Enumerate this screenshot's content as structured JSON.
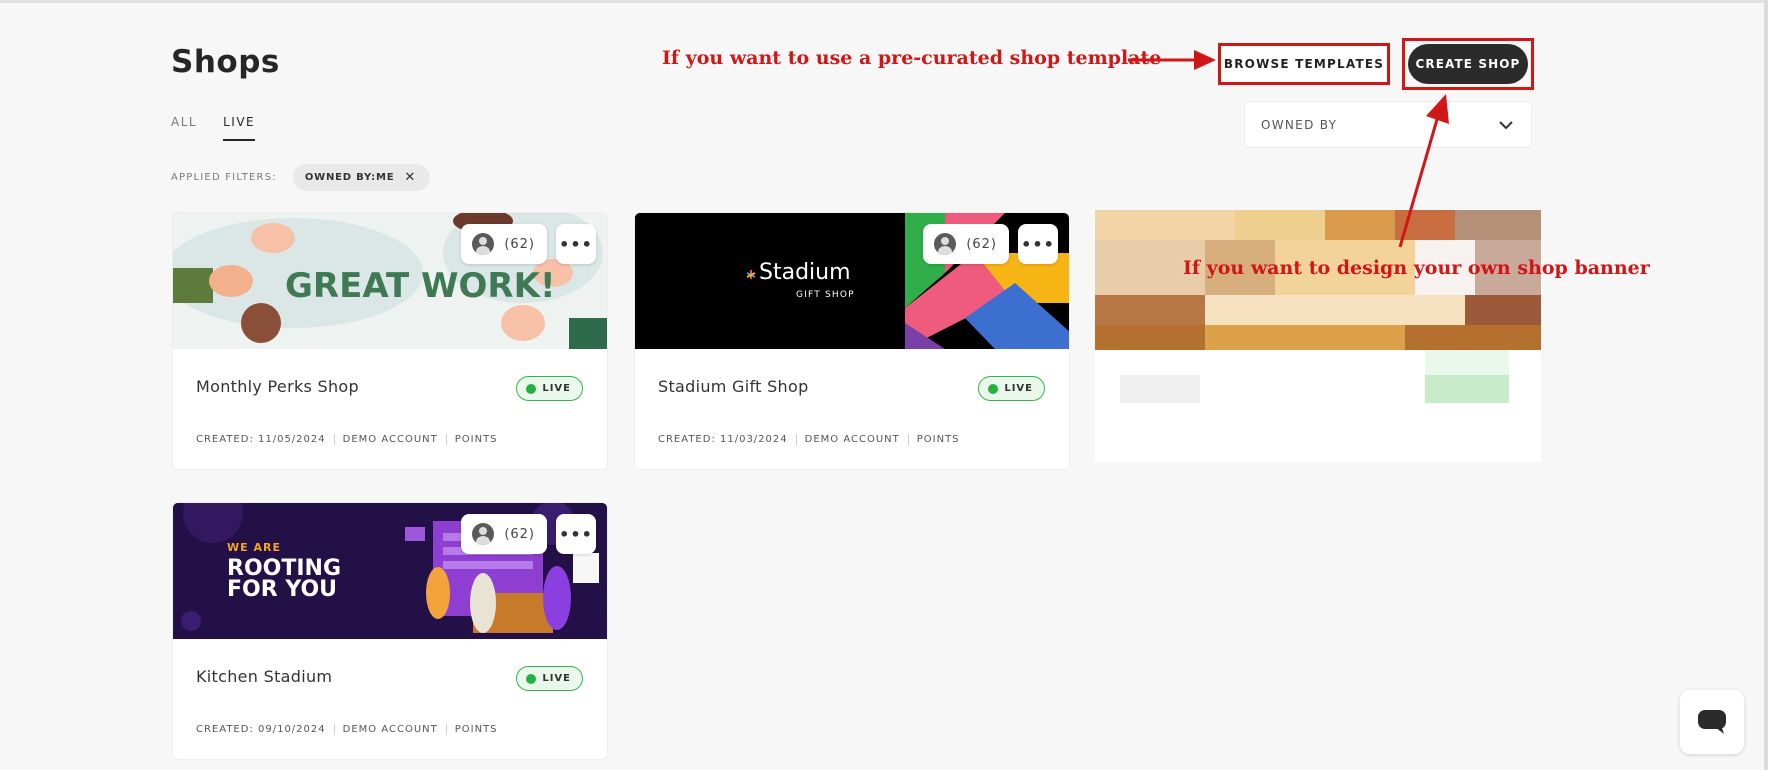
{
  "page": {
    "title": "Shops"
  },
  "tabs": [
    {
      "label": "ALL"
    },
    {
      "label": "LIVE"
    }
  ],
  "filters": {
    "label": "APPLIED FILTERS:",
    "chip": "OWNED BY:ME"
  },
  "actions": {
    "browse_label": "BROWSE TEMPLATES",
    "create_label": "CREATE SHOP"
  },
  "owned_by": {
    "label": "OWNED BY"
  },
  "annotations": {
    "browse_note": "If you want to use a pre-curated shop template",
    "create_note": "If you want to design your own shop banner"
  },
  "cards": [
    {
      "name": "Monthly Perks Shop",
      "status": "LIVE",
      "owner_count": "(62)",
      "created": "CREATED: 11/05/2024",
      "account": "DEMO ACCOUNT",
      "currency": "POINTS",
      "banner_text": "GREAT WORK!"
    },
    {
      "name": "Stadium Gift Shop",
      "status": "LIVE",
      "owner_count": "(62)",
      "created": "CREATED: 11/03/2024",
      "account": "DEMO ACCOUNT",
      "currency": "POINTS",
      "banner_title": "Stadium",
      "banner_sub": "GIFT SHOP"
    },
    {
      "name": "Kitchen Stadium",
      "status": "LIVE",
      "owner_count": "(62)",
      "created": "CREATED: 09/10/2024",
      "account": "DEMO ACCOUNT",
      "currency": "POINTS",
      "banner_kicker": "WE ARE",
      "banner_line1": "ROOTING",
      "banner_line2": "FOR YOU"
    }
  ],
  "colors": {
    "accent_dark": "#2b2b2b",
    "live_green": "#26b040",
    "annotation_red": "#d01616"
  },
  "icons": {
    "more": "more-horizontal-icon",
    "avatar": "user-avatar-icon",
    "chevron": "chevron-down-icon",
    "close": "close-icon",
    "chat": "chat-icon"
  }
}
